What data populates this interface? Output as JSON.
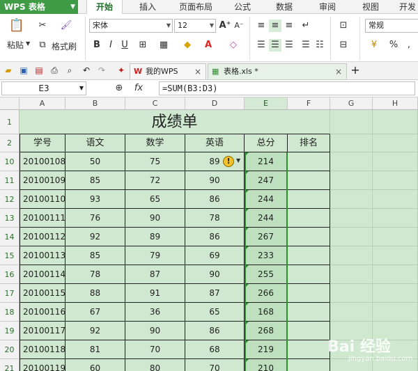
{
  "app": {
    "logo": "WPS 表格",
    "menu_tabs": [
      "开始",
      "插入",
      "页面布局",
      "公式",
      "数据",
      "审阅",
      "视图",
      "开发"
    ]
  },
  "ribbon": {
    "paste": "粘贴",
    "format_painter": "格式刷",
    "font_name": "宋体",
    "font_size": "12",
    "number_format": "常规",
    "bold": "B",
    "italic": "I",
    "underline": "U",
    "percent": "%",
    "comma": ","
  },
  "doc_tabs": [
    {
      "label": "我的WPS"
    },
    {
      "label": "表格.xls *"
    }
  ],
  "formula_bar": {
    "cell_ref": "E3",
    "fx": "fx",
    "formula": "=SUM(B3:D3)"
  },
  "sheet": {
    "columns": [
      "A",
      "B",
      "C",
      "D",
      "E",
      "F",
      "G",
      "H"
    ],
    "title": "成绩单",
    "headers": [
      "学号",
      "语文",
      "数学",
      "英语",
      "总分",
      "排名"
    ],
    "header_row_label": "2",
    "title_row_label": "1",
    "rows": [
      {
        "row": "10",
        "id": "20100108",
        "chinese": "50",
        "math": "75",
        "english": "89",
        "total": "214"
      },
      {
        "row": "11",
        "id": "20100109",
        "chinese": "85",
        "math": "72",
        "english": "90",
        "total": "247"
      },
      {
        "row": "12",
        "id": "20100110",
        "chinese": "93",
        "math": "65",
        "english": "86",
        "total": "244"
      },
      {
        "row": "13",
        "id": "20100111",
        "chinese": "76",
        "math": "90",
        "english": "78",
        "total": "244"
      },
      {
        "row": "14",
        "id": "20100112",
        "chinese": "92",
        "math": "89",
        "english": "86",
        "total": "267"
      },
      {
        "row": "15",
        "id": "20100113",
        "chinese": "85",
        "math": "79",
        "english": "69",
        "total": "233"
      },
      {
        "row": "16",
        "id": "20100114",
        "chinese": "78",
        "math": "87",
        "english": "90",
        "total": "255"
      },
      {
        "row": "17",
        "id": "20100115",
        "chinese": "88",
        "math": "91",
        "english": "87",
        "total": "266"
      },
      {
        "row": "18",
        "id": "20100116",
        "chinese": "67",
        "math": "36",
        "english": "65",
        "total": "168"
      },
      {
        "row": "19",
        "id": "20100117",
        "chinese": "92",
        "math": "90",
        "english": "86",
        "total": "268"
      },
      {
        "row": "20",
        "id": "20100118",
        "chinese": "81",
        "math": "70",
        "english": "68",
        "total": "219"
      },
      {
        "row": "21",
        "id": "20100119",
        "chinese": "60",
        "math": "80",
        "english": "70",
        "total": "210"
      }
    ]
  },
  "watermark": {
    "brand": "Bai 经验",
    "url": "jingyan.baidu.com"
  },
  "colors": {
    "accent": "#3f9b45",
    "sheet_bg": "#cfe8cf",
    "selection": "#2e8f2e"
  },
  "icons": [
    "paste-icon",
    "cut-icon",
    "brush-icon",
    "bold-icon",
    "italic-icon",
    "underline-icon",
    "border-icon",
    "fill-color-icon",
    "font-color-icon",
    "open-icon",
    "save-icon",
    "pdf-icon",
    "print-icon",
    "preview-icon",
    "undo-icon",
    "redo-icon",
    "warning-icon",
    "plus-icon"
  ]
}
